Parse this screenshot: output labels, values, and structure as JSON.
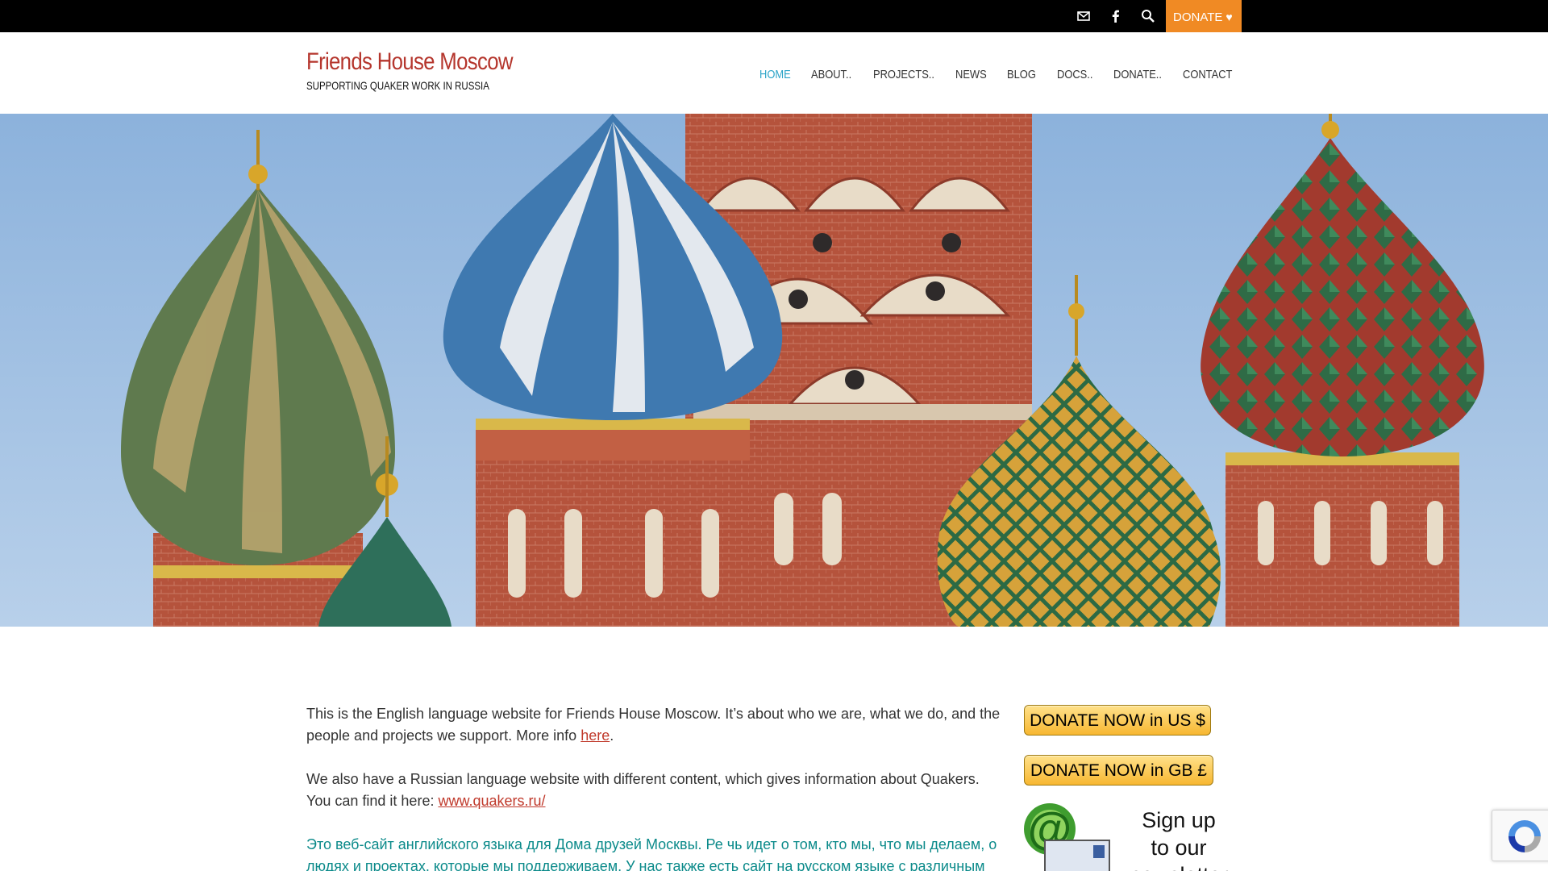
{
  "topbar": {
    "icons": [
      "mail-icon",
      "facebook-icon",
      "search-icon"
    ],
    "donate_label": "DONATE",
    "donate_icon": "heart-icon",
    "background": "#000000",
    "donate_color": "#f08a24"
  },
  "header": {
    "title": "Friends House Moscow",
    "tagline": "SUPPORTING QUAKER WORK IN RUSSIA",
    "title_color": "#b5362d"
  },
  "nav": {
    "items": [
      "HOME",
      "ABOUT..",
      "PROJECTS..",
      "NEWS",
      "BLOG",
      "DOCS..",
      "DONATE..",
      "CONTACT"
    ],
    "active": "HOME",
    "active_color": "#2aa3c7"
  },
  "content": {
    "p1_text": "This is the English language website for Friends House Moscow. It’s about who we are, what we do, and the people and projects we support. More info ",
    "p1_link": "here",
    "p1_end": ".",
    "p2_text": "We also have a Russian language website with different content, which gives information about Quakers. You can find it here: ",
    "p2_link": "www.quakers.ru/",
    "p3_text": "Это веб-сайт английского языка для Дома друзей Москвы. Ре чь идет о том, кто мы, что мы делаем, о людях и проектах, которые мы поддерживаем. У нас также есть сайт на русском языке с различным"
  },
  "sidebar": {
    "donate_us": "DONATE NOW in US $",
    "donate_gb": "DONATE NOW in GB £",
    "newsletter_line1": "Sign up",
    "newsletter_line2": "to our",
    "newsletter_line3": "newsletter"
  },
  "recaptcha": {
    "icon": "recaptcha-icon"
  }
}
